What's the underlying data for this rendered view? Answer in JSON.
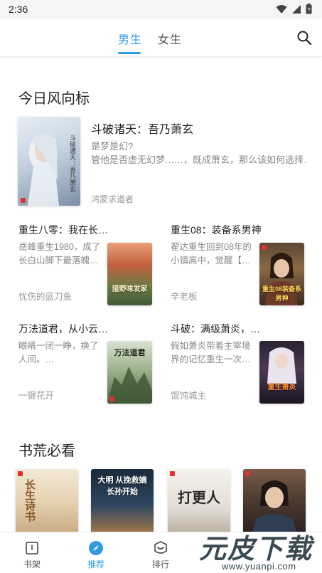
{
  "status_bar": {
    "time": "2:36",
    "icons": [
      "wifi-icon",
      "signal-icon",
      "battery-icon"
    ]
  },
  "top_tabs": [
    {
      "label": "男生",
      "active": true
    },
    {
      "label": "女生",
      "active": false
    }
  ],
  "search_icon": "search-icon",
  "accent_color": "#2e9be3",
  "sections": {
    "featured_title": "今日风向标",
    "must_read_title": "书荒必看"
  },
  "featured_book": {
    "title": "斗破诸天：吾乃萧玄",
    "desc_line1": "是梦是幻?",
    "desc_line2": "管他是否虚无幻梦……，既成萧玄，那么该如何选择…",
    "author": "鸿蒙求道者",
    "cover_text": "斗破诸天：吾乃萧玄"
  },
  "grid_books": [
    {
      "title": "重生八零：我在长…",
      "desc_line1": "岳峰重生1980，成了",
      "desc_line2": "长白山脚下最落魄…",
      "author": "忧伤的蓝刀鱼",
      "cover_text": "猎野味发家"
    },
    {
      "title": "重生08：装备系男神",
      "desc_line1": "翟达重生回到08年的",
      "desc_line2": "小镇高中，觉醒【…",
      "author": "辛老板",
      "cover_text": "重生08装备系男神"
    },
    {
      "title": "万法道君，从小云…",
      "desc_line1": "眼睛一闭一睁，换了",
      "desc_line2": "人间。…",
      "author": "一键花开",
      "cover_text": "万法道君"
    },
    {
      "title": "斗破：满级萧炎，…",
      "desc_line1": "假如萧炎带着主宰境",
      "desc_line2": "界的记忆重生一次…",
      "author": "馄饨城主",
      "cover_text": "重生萧炎"
    }
  ],
  "must_read_covers": [
    {
      "cover_text": "长生诗书"
    },
    {
      "cover_text": "大明 从挽救嫡长孙开始"
    },
    {
      "cover_text": "打更人"
    },
    {
      "cover_text": ""
    }
  ],
  "bottom_nav": [
    {
      "label": "书架",
      "icon": "bookshelf-icon",
      "active": false
    },
    {
      "label": "推荐",
      "icon": "compass-icon",
      "active": true
    },
    {
      "label": "排行",
      "icon": "ranking-icon",
      "active": false
    }
  ],
  "watermark": {
    "text": "元皮下载",
    "url": "www.yuanpi.com"
  }
}
